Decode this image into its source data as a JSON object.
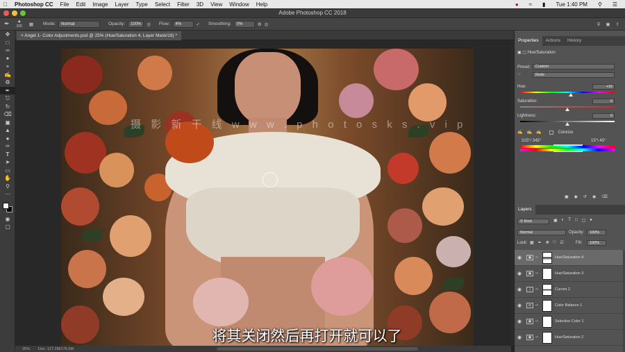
{
  "menubar": {
    "app": "Photoshop CC",
    "items": [
      "File",
      "Edit",
      "Image",
      "Layer",
      "Type",
      "Select",
      "Filter",
      "3D",
      "View",
      "Window",
      "Help"
    ],
    "clock": "Tue 1:40 PM"
  },
  "window_title": "Adobe Photoshop CC 2018",
  "options": {
    "brush_size": "200",
    "mode_label": "Mode:",
    "mode_value": "Normal",
    "opacity_label": "Opacity:",
    "opacity_value": "100%",
    "flow_label": "Flow:",
    "flow_value": "4%",
    "smoothing_label": "Smoothing:",
    "smoothing_value": "0%"
  },
  "document_tab": "Angel 1- Color Adjustments.psd @ 25% (Hue/Saturation 4, Layer Mask/16) *",
  "status": {
    "zoom": "25%",
    "doc": "Doc: 127.2M/176.5M"
  },
  "watermark": "摄 影 新 干 线   w w w . p h o t o s k s . v i p",
  "subtitle": "将其关闭然后再打开就可以了",
  "properties": {
    "tabs": [
      "Properties",
      "Actions",
      "History"
    ],
    "title": "Hue/Saturation",
    "preset_label": "Preset:",
    "preset_value": "Custom",
    "channel_value": "Reds",
    "hue_label": "Hue:",
    "hue_value": "+16",
    "hue_fraction": 0.54,
    "saturation_label": "Saturation:",
    "saturation_value": "0",
    "saturation_fraction": 0.5,
    "lightness_label": "Lightness:",
    "lightness_value": "0",
    "lightness_fraction": 0.5,
    "colorize_label": "Colorize",
    "range_left": "315°/ 345°",
    "range_right": "15°\\ 45°"
  },
  "layers": {
    "tab": "Layers",
    "kind_label": "Kind",
    "blend_value": "Normal",
    "opacity_label": "Opacity:",
    "opacity_value": "100%",
    "lock_label": "Lock:",
    "fill_label": "Fill:",
    "fill_value": "100%",
    "items": [
      {
        "name": "Hue/Saturation 4",
        "active": true
      },
      {
        "name": "Hue/Saturation 3",
        "active": false
      },
      {
        "name": "Curves 2",
        "active": false
      },
      {
        "name": "Color Balance 1",
        "active": false
      },
      {
        "name": "Selective Color 1",
        "active": false
      },
      {
        "name": "Hue/Saturation 2",
        "active": false
      }
    ]
  }
}
